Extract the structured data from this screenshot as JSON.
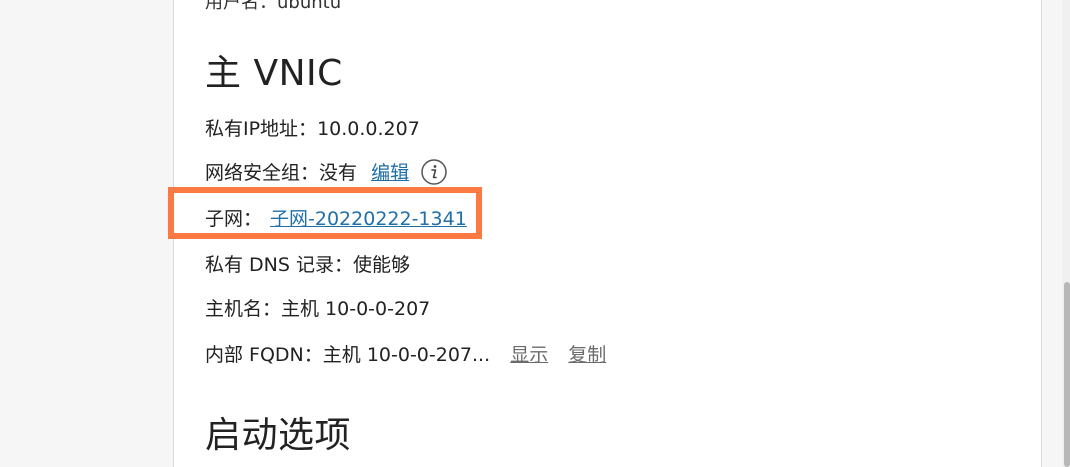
{
  "top_cut_text": "用户名：ubuntu",
  "primary_vnic": {
    "title": "主 VNIC",
    "private_ip_label": "私有IP地址：",
    "private_ip_value": "10.0.0.207",
    "nsg_label": "网络安全组：",
    "nsg_value": "没有",
    "nsg_edit_link": "编辑",
    "info_icon": "info-icon",
    "subnet_label": "子网：",
    "subnet_link": "子网-20220222-1341",
    "dns_label": "私有 DNS 记录：",
    "dns_value": "使能够",
    "hostname_label": "主机名：",
    "hostname_value": "主机 10-0-0-207",
    "fqdn_label": "内部 FQDN：",
    "fqdn_value": "主机 10-0-0-207...",
    "fqdn_show_link": "显示",
    "fqdn_copy_link": "复制"
  },
  "launch_options": {
    "title": "启动选项"
  },
  "colors": {
    "link": "#1f6fa8",
    "highlight": "#fb7a43",
    "muted_link": "#6b6b6b"
  }
}
